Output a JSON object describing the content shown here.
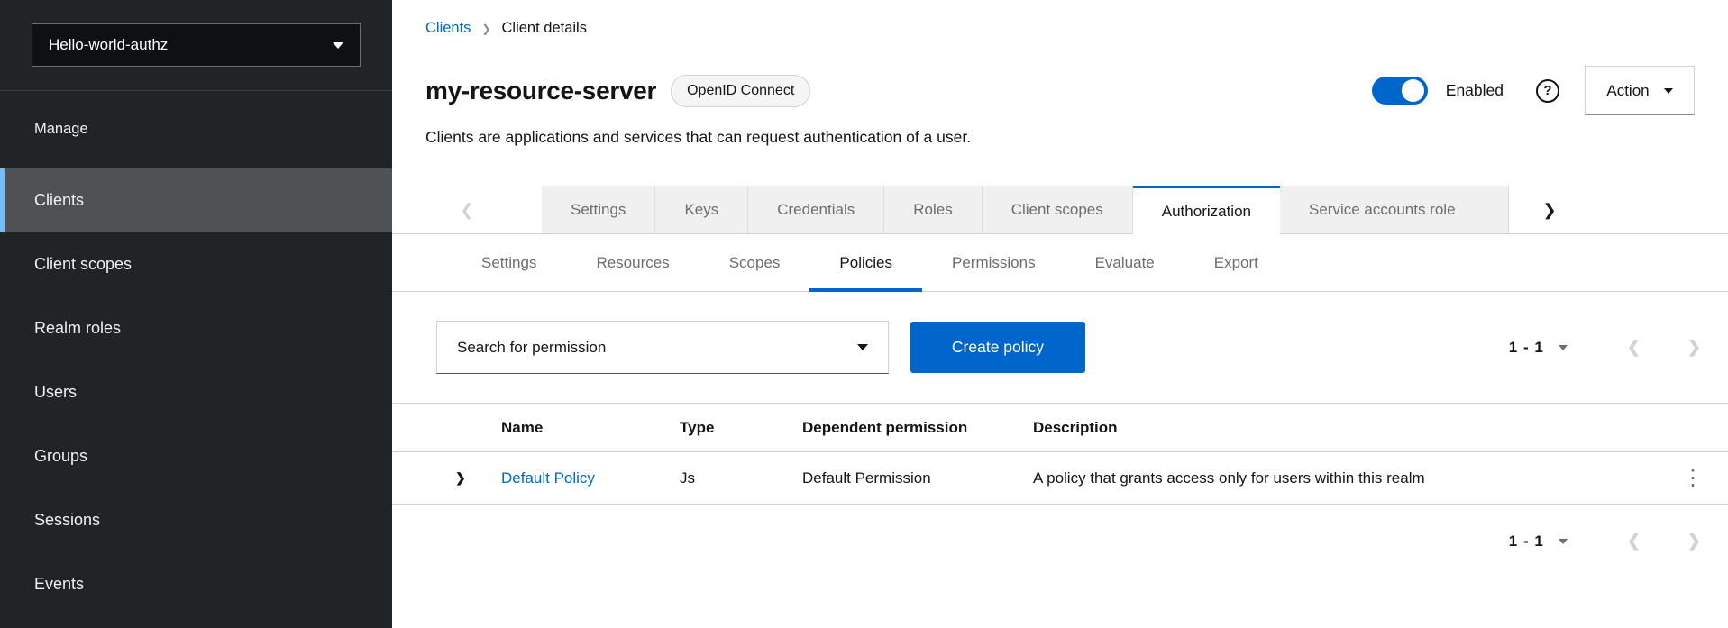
{
  "sidebar": {
    "realm_selector": {
      "label": "Hello-world-authz"
    },
    "section_label": "Manage",
    "items": [
      {
        "label": "Clients",
        "selected": true
      },
      {
        "label": "Client scopes",
        "selected": false
      },
      {
        "label": "Realm roles",
        "selected": false
      },
      {
        "label": "Users",
        "selected": false
      },
      {
        "label": "Groups",
        "selected": false
      },
      {
        "label": "Sessions",
        "selected": false
      },
      {
        "label": "Events",
        "selected": false
      }
    ]
  },
  "breadcrumb": {
    "items": [
      "Clients",
      "Client details"
    ]
  },
  "header": {
    "title": "my-resource-server",
    "badge": "OpenID Connect",
    "subtitle": "Clients are applications and services that can request authentication of a user.",
    "enabled_label": "Enabled",
    "action_label": "Action"
  },
  "tabs": {
    "items": [
      "Settings",
      "Keys",
      "Credentials",
      "Roles",
      "Client scopes",
      "Authorization",
      "Service accounts role"
    ],
    "active": "Authorization"
  },
  "subtabs": {
    "items": [
      "Settings",
      "Resources",
      "Scopes",
      "Policies",
      "Permissions",
      "Evaluate",
      "Export"
    ],
    "active": "Policies"
  },
  "toolbar": {
    "search_label": "Search for permission",
    "create_button": "Create policy",
    "pagination": "1 - 1"
  },
  "table": {
    "headers": [
      "Name",
      "Type",
      "Dependent permission",
      "Description"
    ],
    "rows": [
      {
        "name": "Default Policy",
        "type": "Js",
        "dependent_permission": "Default Permission",
        "description": "A policy that grants access only for users within this realm"
      }
    ]
  },
  "footer": {
    "pagination": "1 - 1"
  },
  "icons": {
    "chevron_left": "❮",
    "chevron_right": "❯",
    "expand_chevron": "❯",
    "breadcrumb_separator": "❯",
    "kebab": "⋮",
    "help_question": "?"
  },
  "colors": {
    "primary": "#0066cc",
    "nav_accent": "#73bcf7",
    "sidebar_bg": "#212427"
  }
}
